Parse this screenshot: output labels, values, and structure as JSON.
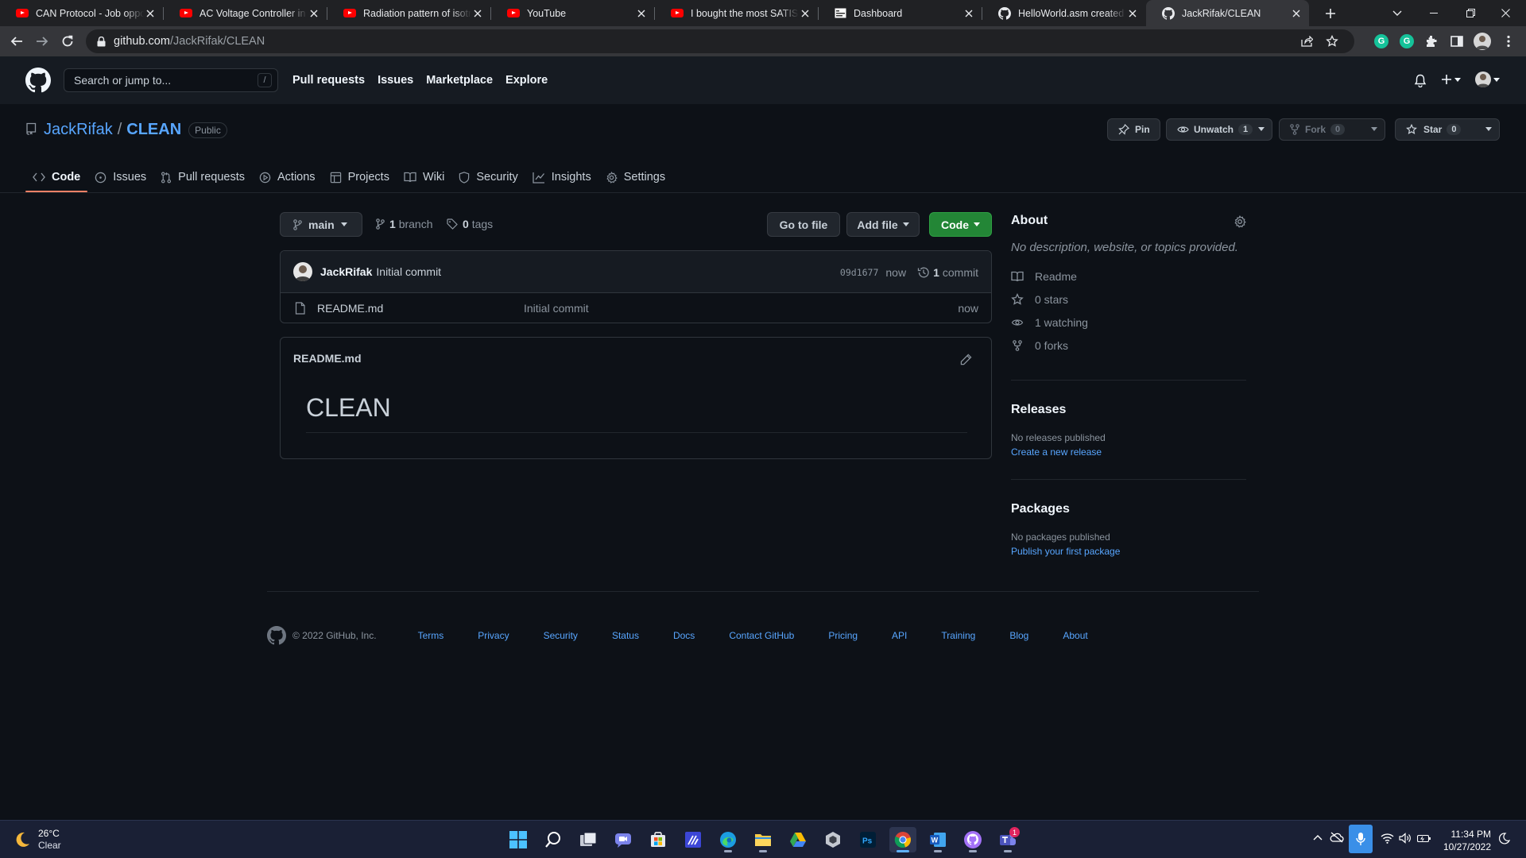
{
  "browser": {
    "tabs": [
      {
        "title": "CAN Protocol - Job opportunities",
        "favicon": "youtube-icon",
        "active": false
      },
      {
        "title": "AC Voltage Controller in tamil",
        "favicon": "youtube-icon",
        "active": false
      },
      {
        "title": "Radiation pattern of isotropic antenna",
        "favicon": "youtube-icon",
        "active": false
      },
      {
        "title": "YouTube",
        "favicon": "youtube-icon",
        "active": false
      },
      {
        "title": "I bought the most SATISFYING",
        "favicon": "youtube-icon",
        "active": false
      },
      {
        "title": "Dashboard",
        "favicon": "dashboard-icon",
        "active": false
      },
      {
        "title": "HelloWorld.asm created by",
        "favicon": "github-icon",
        "active": false
      },
      {
        "title": "JackRifak/CLEAN",
        "favicon": "github-icon",
        "active": true
      }
    ],
    "url_host": "github.com",
    "url_path": "/JackRifak/CLEAN"
  },
  "github_header": {
    "search_placeholder": "Search or jump to...",
    "search_shortcut": "/",
    "nav": [
      "Pull requests",
      "Issues",
      "Marketplace",
      "Explore"
    ]
  },
  "repo": {
    "owner": "JackRifak",
    "separator": "/",
    "name": "CLEAN",
    "visibility": "Public",
    "pin_label": "Pin",
    "unwatch_label": "Unwatch",
    "unwatch_count": "1",
    "fork_label": "Fork",
    "fork_count": "0",
    "star_label": "Star",
    "star_count": "0"
  },
  "repo_tabs": [
    {
      "label": "Code",
      "icon": "code-icon",
      "active": true
    },
    {
      "label": "Issues",
      "icon": "issue-icon",
      "active": false
    },
    {
      "label": "Pull requests",
      "icon": "pull-request-icon",
      "active": false
    },
    {
      "label": "Actions",
      "icon": "play-icon",
      "active": false
    },
    {
      "label": "Projects",
      "icon": "table-icon",
      "active": false
    },
    {
      "label": "Wiki",
      "icon": "book-icon",
      "active": false
    },
    {
      "label": "Security",
      "icon": "shield-icon",
      "active": false
    },
    {
      "label": "Insights",
      "icon": "graph-icon",
      "active": false
    },
    {
      "label": "Settings",
      "icon": "gear-icon",
      "active": false
    }
  ],
  "code": {
    "branch": "main",
    "branch_count": "1",
    "branch_word": "branch",
    "tag_count": "0",
    "tag_word": "tags",
    "go_to_file": "Go to file",
    "add_file": "Add file",
    "code_button": "Code",
    "commit": {
      "author": "JackRifak",
      "message": "Initial commit",
      "sha": "09d1677",
      "time": "now",
      "count": "1",
      "count_word": "commit"
    },
    "files": [
      {
        "name": "README.md",
        "message": "Initial commit",
        "time": "now"
      }
    ],
    "readme": {
      "filename": "README.md",
      "heading": "CLEAN"
    }
  },
  "about": {
    "title": "About",
    "description": "No description, website, or topics provided.",
    "items": [
      {
        "icon": "book-icon",
        "label": "Readme"
      },
      {
        "icon": "star-icon",
        "label": "0 stars"
      },
      {
        "icon": "eye-icon",
        "label": "1 watching"
      },
      {
        "icon": "fork-icon",
        "label": "0 forks"
      }
    ]
  },
  "releases": {
    "title": "Releases",
    "empty": "No releases published",
    "link": "Create a new release"
  },
  "packages": {
    "title": "Packages",
    "empty": "No packages published",
    "link": "Publish your first package"
  },
  "footer": {
    "copyright": "© 2022 GitHub, Inc.",
    "links": [
      "Terms",
      "Privacy",
      "Security",
      "Status",
      "Docs",
      "Contact GitHub",
      "Pricing",
      "API",
      "Training",
      "Blog",
      "About"
    ]
  },
  "taskbar": {
    "weather_temp": "26°C",
    "weather_desc": "Clear",
    "time": "11:34 PM",
    "date": "10/27/2022",
    "teams_badge": "1"
  },
  "colors": {
    "page_bg": "#0d1117",
    "header_bg": "#161b22",
    "link": "#58a6ff",
    "primary_button": "#238636",
    "active_tab_underline": "#f78166"
  }
}
